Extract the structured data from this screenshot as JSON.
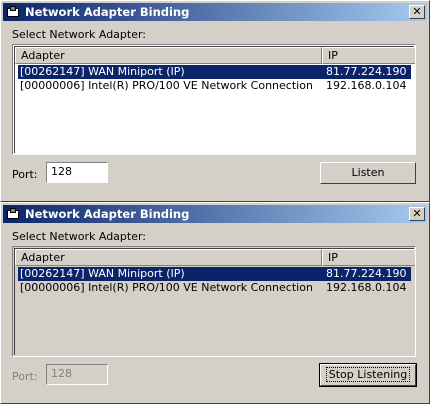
{
  "windows": [
    {
      "title": "Network Adapter Binding",
      "close_label": "✕",
      "select_label": "Select Network Adapter:",
      "columns": [
        "Adapter",
        "IP"
      ],
      "rows": [
        {
          "adapter": "[00262147] WAN Miniport (IP)",
          "ip": "81.77.224.190",
          "selected": true
        },
        {
          "adapter": "[00000006] Intel(R) PRO/100 VE Network Connection",
          "ip": "192.168.0.104",
          "selected": false
        }
      ],
      "port_label": "Port:",
      "port_value": "128",
      "port_enabled": true,
      "button_label": "Listen"
    },
    {
      "title": "Network Adapter Binding",
      "close_label": "✕",
      "select_label": "Select Network Adapter:",
      "columns": [
        "Adapter",
        "IP"
      ],
      "rows": [
        {
          "adapter": "[00262147] WAN Miniport (IP)",
          "ip": "81.77.224.190",
          "selected": true
        },
        {
          "adapter": "[00000006] Intel(R) PRO/100 VE Network Connection",
          "ip": "192.168.0.104",
          "selected": false
        }
      ],
      "port_label": "Port:",
      "port_value": "128",
      "port_enabled": false,
      "button_label": "Stop Listening"
    }
  ]
}
